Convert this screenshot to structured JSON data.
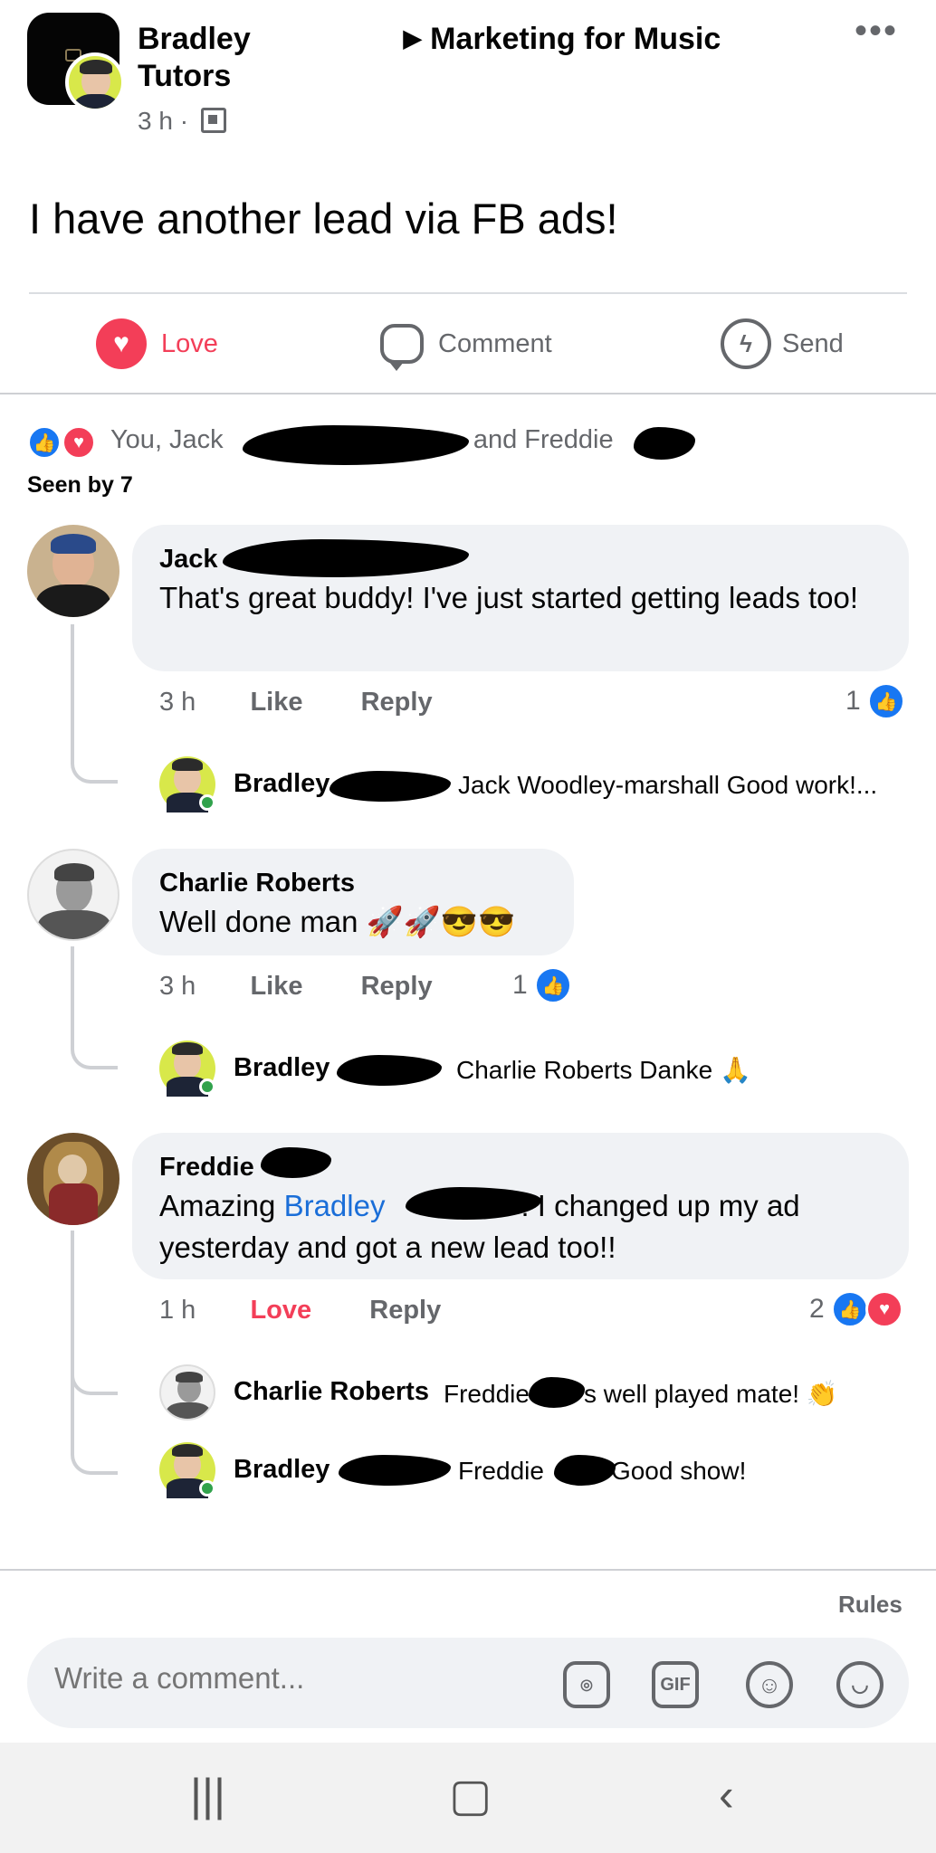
{
  "post": {
    "author_first": "Bradley",
    "author_second_line": "Tutors",
    "group_name": "Marketing for Music",
    "time": "3 h ·",
    "text": "I have another lead via FB ads!"
  },
  "actions": {
    "love": "Love",
    "comment": "Comment",
    "send": "Send"
  },
  "reactions": {
    "you_and": "You, Jack",
    "and_freddie": "and Freddie",
    "seen_by": "Seen by 7"
  },
  "comments": [
    {
      "name": "Jack",
      "text": "That's great buddy! I've just started getting leads too!",
      "time": "3 h",
      "action": "Like",
      "reply": "Reply",
      "reaction_count": "1",
      "replies": [
        {
          "name": "Bradley",
          "text": "Jack Woodley-marshall Good work!..."
        }
      ]
    },
    {
      "name": "Charlie Roberts",
      "text": "Well done man 🚀🚀😎😎",
      "time": "3 h",
      "action": "Like",
      "reply": "Reply",
      "reaction_count": "1",
      "replies": [
        {
          "name": "Bradley",
          "text": "Charlie Roberts Danke 🙏"
        }
      ]
    },
    {
      "name": "Freddie",
      "text_before": "Amazing",
      "mention": "Bradley",
      "text_after": "! I changed up my ad yesterday and got a new lead too!!",
      "time": "1 h",
      "action": "Love",
      "reply": "Reply",
      "reaction_count": "2",
      "replies": [
        {
          "name": "Charlie Roberts",
          "text_a": "Freddie",
          "text_b": "s well played mate! 👏"
        },
        {
          "name": "Bradley",
          "text_a": "Freddie",
          "text_b": "Good show!"
        }
      ]
    }
  ],
  "footer": {
    "rules": "Rules",
    "composer_placeholder": "Write a comment...",
    "gif_label": "GIF"
  },
  "colors": {
    "accent_blue": "#1877f2",
    "love_red": "#f33e58",
    "bubble_bg": "#f0f2f5"
  }
}
